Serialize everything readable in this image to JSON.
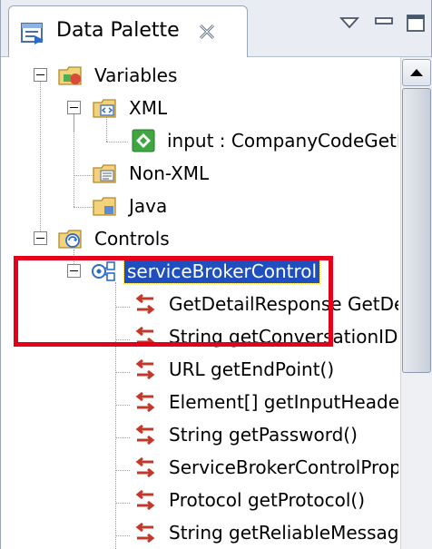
{
  "view": {
    "title": "Data Palette",
    "icon": "data-palette-icon",
    "toolbar_icons": [
      "view-menu-icon",
      "minimize-icon",
      "maximize-icon"
    ]
  },
  "tree": {
    "variables": {
      "label": "Variables",
      "xml": {
        "label": "XML",
        "children": [
          "input : CompanyCodeGetD"
        ]
      },
      "non_xml": "Non-XML",
      "java": "Java"
    },
    "controls": {
      "label": "Controls",
      "service_broker": {
        "label": "serviceBrokerControl",
        "methods": [
          "GetDetailResponse GetDe",
          "String getConversationID(",
          "URL getEndPoint()",
          "Element[] getInputHeader",
          "String getPassword()",
          "ServiceBrokerControlPropo",
          "Protocol getProtocol()",
          "String getReliableMessage"
        ]
      }
    }
  },
  "colors": {
    "selection": "#1f4fbf",
    "highlight_box": "#e4001b",
    "method_icon": "#c0392b"
  }
}
